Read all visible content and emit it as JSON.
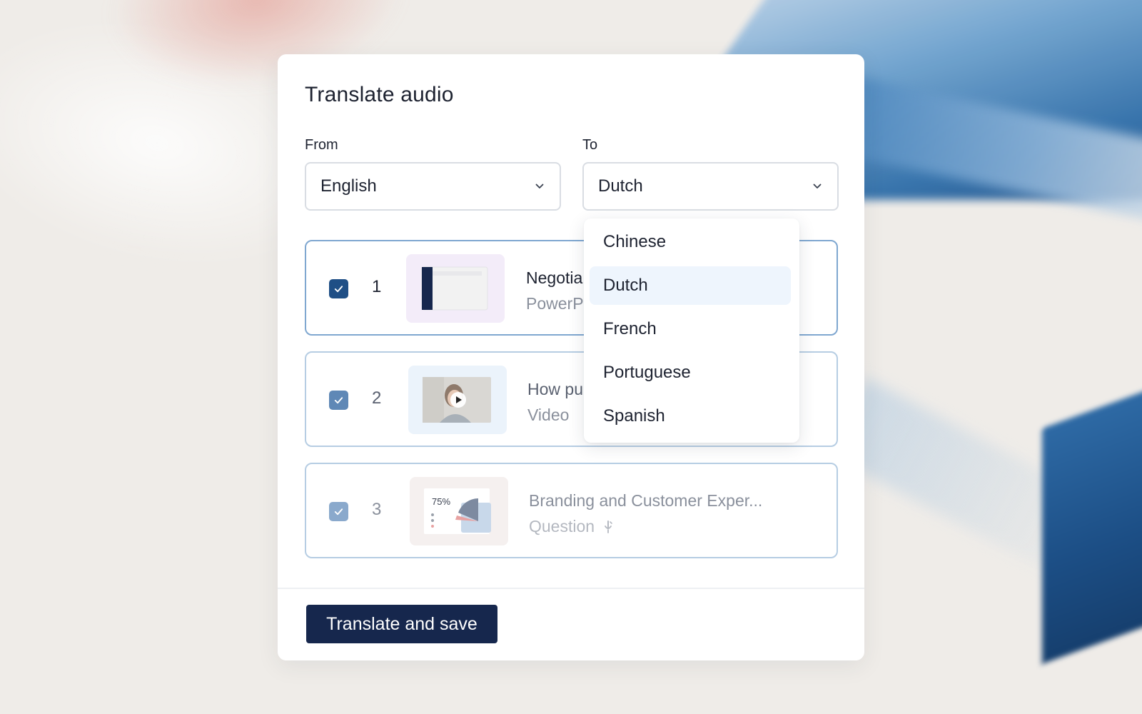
{
  "modal": {
    "title": "Translate audio",
    "from_label": "From",
    "to_label": "To",
    "from_value": "English",
    "to_value": "Dutch",
    "submit_label": "Translate and save"
  },
  "dropdown": {
    "options": [
      "Chinese",
      "Dutch",
      "French",
      "Portuguese",
      "Spanish"
    ],
    "selected": "Dutch"
  },
  "items": [
    {
      "number": "1",
      "title": "Negotia",
      "subtitle": "PowerP",
      "checked": true,
      "thumb": "slide-thumbnail-icon"
    },
    {
      "number": "2",
      "title": "How pu",
      "subtitle": "Video",
      "checked": true,
      "thumb": "video-thumbnail-icon"
    },
    {
      "number": "3",
      "title": "Branding and Customer Exper...",
      "subtitle": "Question",
      "checked": true,
      "thumb": "chart-thumbnail-icon",
      "thumb_percent": "75%"
    }
  ],
  "colors": {
    "primary": "#16274d",
    "accent_border": "#7fa7d0",
    "checkbox": "#1f4f86",
    "selected_option_bg": "#eef5fd"
  }
}
